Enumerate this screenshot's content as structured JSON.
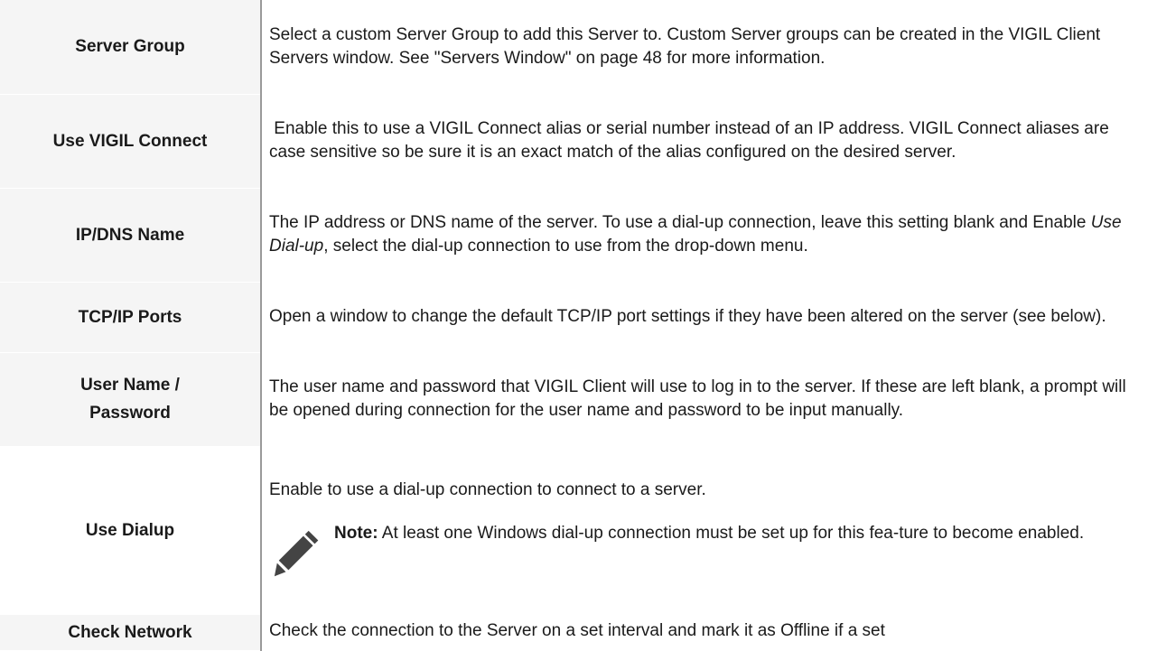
{
  "rows": [
    {
      "label": "Server Group",
      "desc": "Select a custom Server Group to add this Server to. Custom Server groups can be created in the VIGIL Client Servers window. See \"Servers Window\" on page 48 for more information."
    },
    {
      "label": "Use VIGIL Connect",
      "desc": " Enable this to use a VIGIL Connect alias or serial number instead of an IP address. VIGIL Connect aliases are case sensitive so be sure it is an exact match of the alias configured on the desired server."
    },
    {
      "label": "IP/DNS Name",
      "desc_before": "The IP address or DNS name of the server.  To use a dial-up connection, leave this setting blank and Enable ",
      "desc_em": "Use Dial-up",
      "desc_after": ", select the dial-up connection to use from the drop-down menu."
    },
    {
      "label": "TCP/IP Ports",
      "desc": "Open a window to change the default TCP/IP port settings if they have been altered on the server (see below)."
    },
    {
      "label_line1": "User Name /",
      "label_line2": "Password",
      "desc": "The user name and password that VIGIL Client will use to log in to the server.  If these are left blank, a prompt will be opened during connection for the user name and password to be input manually."
    },
    {
      "label": "Use Dialup",
      "desc": "Enable to use a dial-up connection to connect to a server.",
      "note_label": "Note:",
      "note_text": " At least one Windows dial-up connection must be set up for this fea-ture to become enabled.",
      "note_icon": "pencil-icon"
    },
    {
      "label": "Check Network",
      "desc": "Check the connection to the Server on a set interval and mark it as Offline if a set"
    }
  ]
}
